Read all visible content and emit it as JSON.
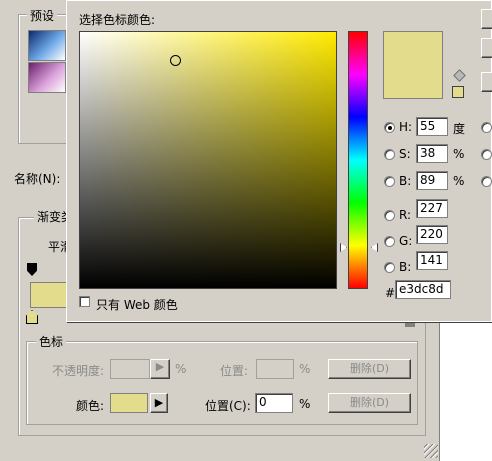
{
  "gradient_editor": {
    "presets_label": "预设",
    "name_label": "名称(N):",
    "gradient_type_label": "渐变类",
    "smoothness_label": "平滑",
    "stops_group_label": "色标",
    "opacity_label": "不透明度:",
    "opacity_unit": "%",
    "location_label_1": "位置:",
    "location_unit_1": "%",
    "delete_button_1": "删除(D)",
    "color_label": "颜色:",
    "location_label_2": "位置(C):",
    "location_value_2": "0",
    "location_unit_2": "%",
    "delete_button_2": "删除(D)",
    "swatch_color": "#e3dc8d"
  },
  "color_picker": {
    "title": "选择色标颜色:",
    "web_only_label": "只有 Web 颜色",
    "new_color": "#e3dc8d",
    "fields": {
      "H": {
        "label": "H:",
        "value": "55",
        "unit": "度"
      },
      "S": {
        "label": "S:",
        "value": "38",
        "unit": "%"
      },
      "B": {
        "label": "B:",
        "value": "89",
        "unit": "%"
      },
      "R": {
        "label": "R:",
        "value": "227"
      },
      "G": {
        "label": "G:",
        "value": "220"
      },
      "Bl": {
        "label": "B:",
        "value": "141"
      }
    },
    "hex_label": "#",
    "hex_value": "e3dc8d"
  }
}
